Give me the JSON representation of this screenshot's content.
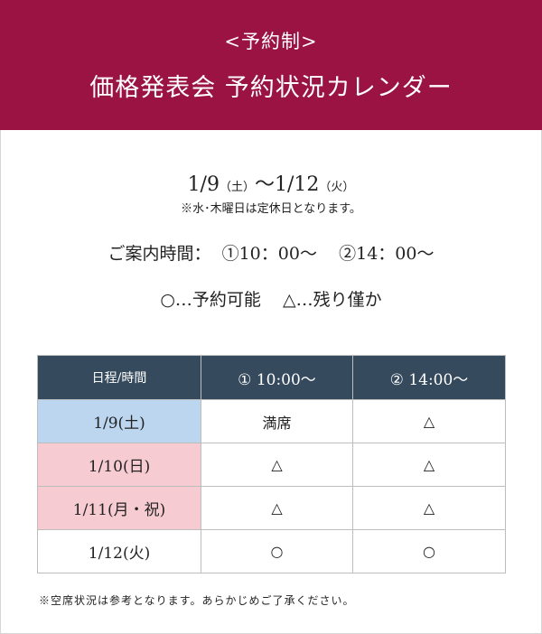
{
  "header": {
    "subtitle": "<予約制>",
    "title": "価格発表会 予約状況カレンダー"
  },
  "period": {
    "start": "1/9",
    "start_day": "（土）",
    "separator": "～",
    "end": "1/12",
    "end_day": "（火）"
  },
  "closed_note": "※水･木曜日は定休日となります。",
  "times_text": "ご案内時間：  ①10：00～    ②14：00～",
  "legend_text": "○…予約可能    △…残り僅か",
  "table": {
    "headers": [
      "日程/時間",
      "①  10:00～",
      "②  14:00～"
    ],
    "rows": [
      {
        "date": "1/9(土)",
        "slot1": "満席",
        "slot2": "△"
      },
      {
        "date": "1/10(日)",
        "slot1": "△",
        "slot2": "△"
      },
      {
        "date": "1/11(月・祝)",
        "slot1": "△",
        "slot2": "△"
      },
      {
        "date": "1/12(火)",
        "slot1": "○",
        "slot2": "○"
      }
    ]
  },
  "footnote": "※空席状況は参考となります。あらかじめご了承ください。",
  "colors": {
    "header_bg": "#9b1342",
    "table_header_bg": "#354a5d",
    "saturday_bg": "#bcd6f0",
    "holiday_bg": "#f6cbd1"
  }
}
